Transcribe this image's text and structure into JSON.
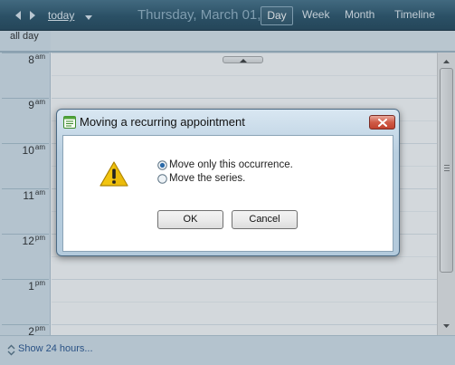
{
  "toolbar": {
    "today_label": "today",
    "date_title": "Thursday, March 01,",
    "views": {
      "day": "Day",
      "week": "Week",
      "month": "Month",
      "timeline": "Timeline"
    },
    "active_view": "Day"
  },
  "allday": {
    "label": "all day"
  },
  "hours": [
    {
      "num": "8",
      "ampm": "am"
    },
    {
      "num": "9",
      "ampm": "am"
    },
    {
      "num": "10",
      "ampm": "am"
    },
    {
      "num": "11",
      "ampm": "am"
    },
    {
      "num": "12",
      "ampm": "pm"
    },
    {
      "num": "1",
      "ampm": "pm"
    },
    {
      "num": "2",
      "ampm": "pm"
    }
  ],
  "footer": {
    "show_hours_label": "Show 24 hours..."
  },
  "dialog": {
    "title": "Moving a recurring appointment",
    "options": [
      {
        "label": "Move only this occurrence.",
        "selected": true
      },
      {
        "label": "Move the series.",
        "selected": false
      }
    ],
    "ok_label": "OK",
    "cancel_label": "Cancel"
  },
  "colors": {
    "toolbar": "#1f4a61",
    "gutter": "#d6e3ec",
    "link": "#1c4b8a",
    "dialog_frame": "#b9cfe0",
    "close_button": "#c0432f",
    "warning": "#f2c40f"
  }
}
